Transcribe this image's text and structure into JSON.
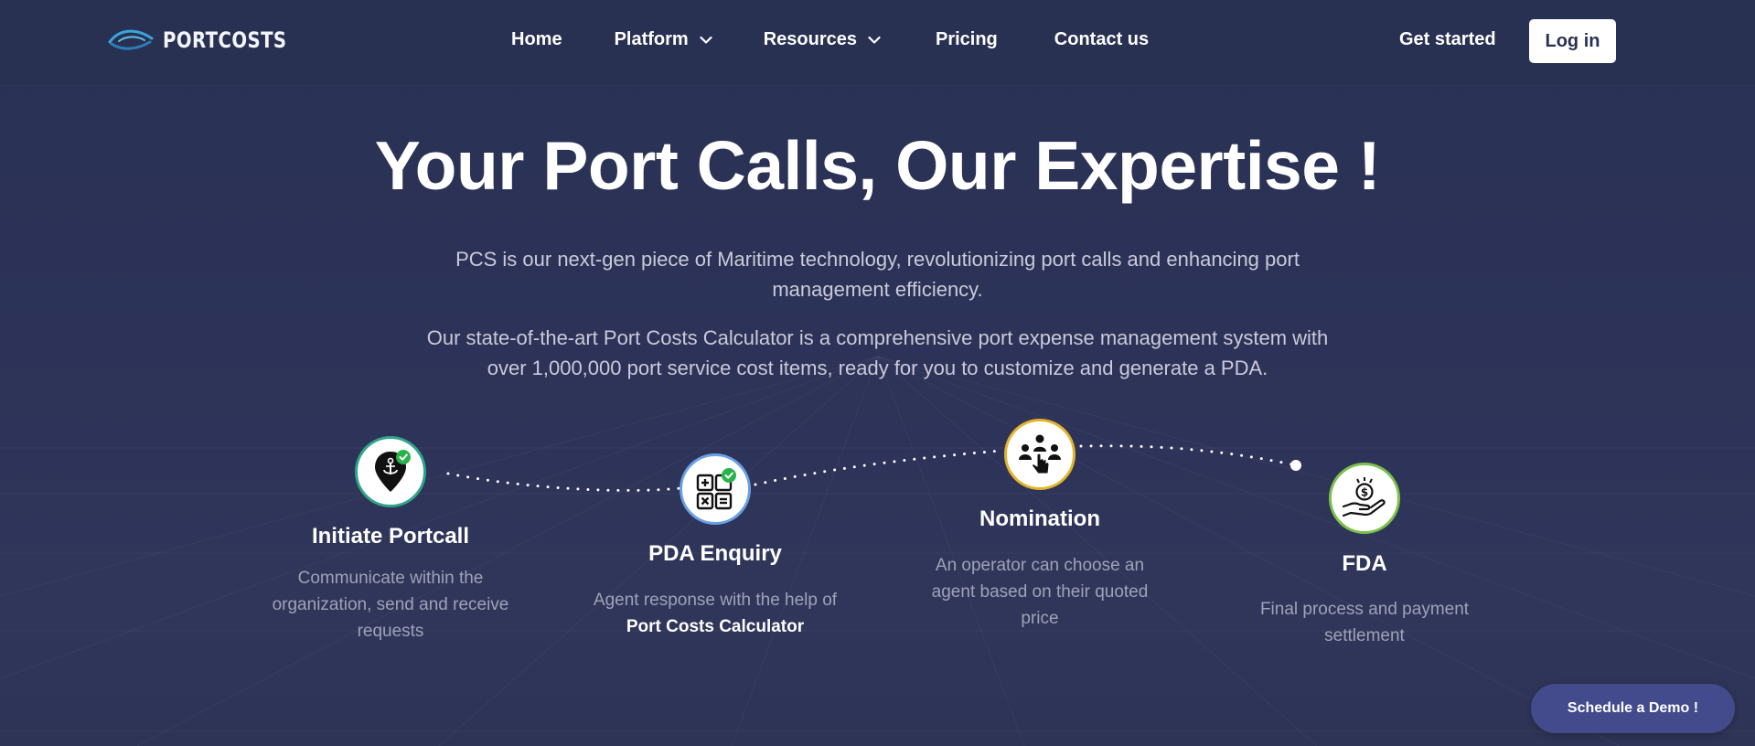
{
  "brand": {
    "name": "PORTCOSTS",
    "icon": "wave-logo-icon"
  },
  "nav": {
    "items": [
      {
        "label": "Home"
      },
      {
        "label": "Platform",
        "icon": "chevron-down-icon"
      },
      {
        "label": "Resources",
        "icon": "chevron-down-icon"
      },
      {
        "label": "Pricing"
      },
      {
        "label": "Contact us"
      }
    ],
    "get_started": "Get started",
    "login": "Log in"
  },
  "hero": {
    "title": "Your Port Calls, Our Expertise !",
    "p1_line1": "PCS is our next-gen piece of Maritime technology, revolutionizing port calls and enhancing port",
    "p1_line2": "management efficiency.",
    "p2_line1": "Our state-of-the-art Port Costs Calculator is a comprehensive port expense management system with",
    "p2_line2": "over 1,000,000 port service cost items, ready for you to customize and generate a PDA."
  },
  "steps": [
    {
      "title": "Initiate Portcall",
      "icon": "anchor-location-pin-icon",
      "accent": "#2fa58a",
      "desc_line1": "Communicate within the",
      "desc_line2": "organization, send and receive",
      "desc_line3": "requests"
    },
    {
      "title": "PDA Enquiry",
      "icon": "calculator-icon",
      "accent": "#6aa0e6",
      "desc_line1": "Agent response with the help of",
      "desc_bold": "Port Costs Calculator"
    },
    {
      "title": "Nomination",
      "icon": "team-selection-icon",
      "accent": "#e4b428",
      "desc_line1": "An operator can choose an",
      "desc_line2": "agent based on their quoted",
      "desc_line3": "price"
    },
    {
      "title": "FDA",
      "icon": "hand-coin-icon",
      "accent": "#7cc24a",
      "desc_line1": "Final process and payment",
      "desc_line2": "settlement"
    }
  ],
  "cta": {
    "schedule_demo": "Schedule a Demo !"
  },
  "colors": {
    "background": "#2d3358",
    "nav_background": "#293153",
    "demo_button": "#434b8c",
    "check_green": "#28b24a"
  }
}
